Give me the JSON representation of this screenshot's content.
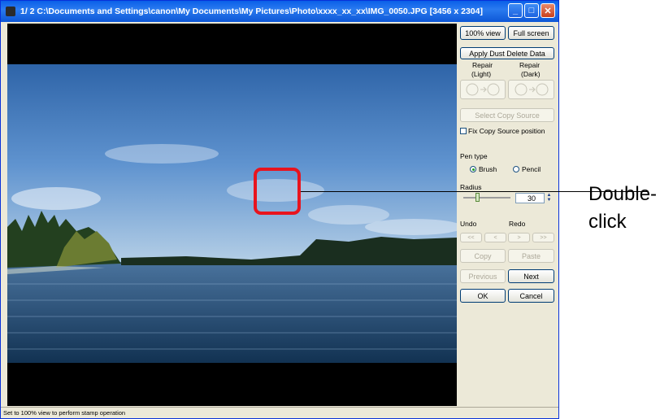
{
  "window": {
    "title": "1/  2  C:\\Documents and Settings\\canon\\My Documents\\My Pictures\\Photo\\xxxx_xx_xx\\IMG_0050.JPG [3456 x 2304]"
  },
  "titlebar_buttons": {
    "minimize": "_",
    "maximize": "□",
    "close": "✕"
  },
  "panel": {
    "view_100": "100% view",
    "full_screen": "Full screen",
    "apply_dust": "Apply Dust Delete Data",
    "repair_light": [
      "Repair",
      "(Light)"
    ],
    "repair_dark": [
      "Repair",
      "(Dark)"
    ],
    "select_copy_source": "Select Copy Source",
    "fix_copy_source": "Fix Copy Source position",
    "pen_type_label": "Pen type",
    "pen_brush": "Brush",
    "pen_pencil": "Pencil",
    "radius_label": "Radius",
    "radius_value": "30",
    "radius_level": 0.3,
    "undo_label": "Undo",
    "redo_label": "Redo",
    "undo_first": "<<",
    "undo_step": "<",
    "redo_step": ">",
    "redo_last": ">>",
    "copy": "Copy",
    "paste": "Paste",
    "previous": "Previous",
    "next": "Next",
    "ok": "OK",
    "cancel": "Cancel"
  },
  "status": "Set to 100% view to perform stamp operation",
  "annotation": {
    "line1": "Double-",
    "line2": "click"
  },
  "colors": {
    "title_bar": "#0a5fe8",
    "highlight": "#e8141e",
    "window_bg": "#ece9d8"
  }
}
